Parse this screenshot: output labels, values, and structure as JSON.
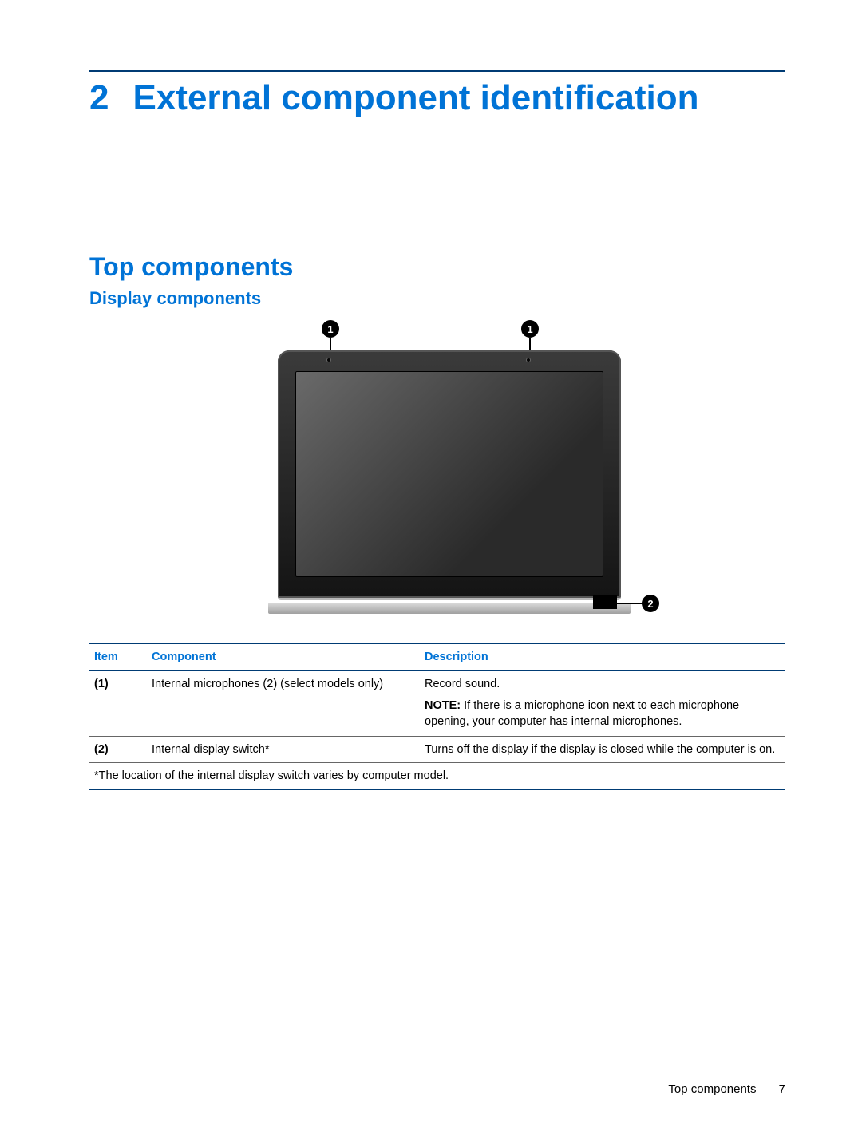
{
  "chapter": {
    "number": "2",
    "title": "External component identification"
  },
  "section": {
    "h1": "Top components",
    "h2": "Display components"
  },
  "callouts": {
    "c1": "1",
    "c2": "2"
  },
  "table": {
    "headers": {
      "item": "Item",
      "component": "Component",
      "description": "Description"
    },
    "rows": [
      {
        "item": "(1)",
        "component": "Internal microphones (2) (select models only)",
        "description": "Record sound.",
        "note_label": "NOTE:",
        "note": "If there is a microphone icon next to each microphone opening, your computer has internal microphones."
      },
      {
        "item": "(2)",
        "component": "Internal display switch*",
        "description": "Turns off the display if the display is closed while the computer is on."
      }
    ],
    "footnote": "*The location of the internal display switch varies by computer model."
  },
  "footer": {
    "section": "Top components",
    "page": "7"
  }
}
